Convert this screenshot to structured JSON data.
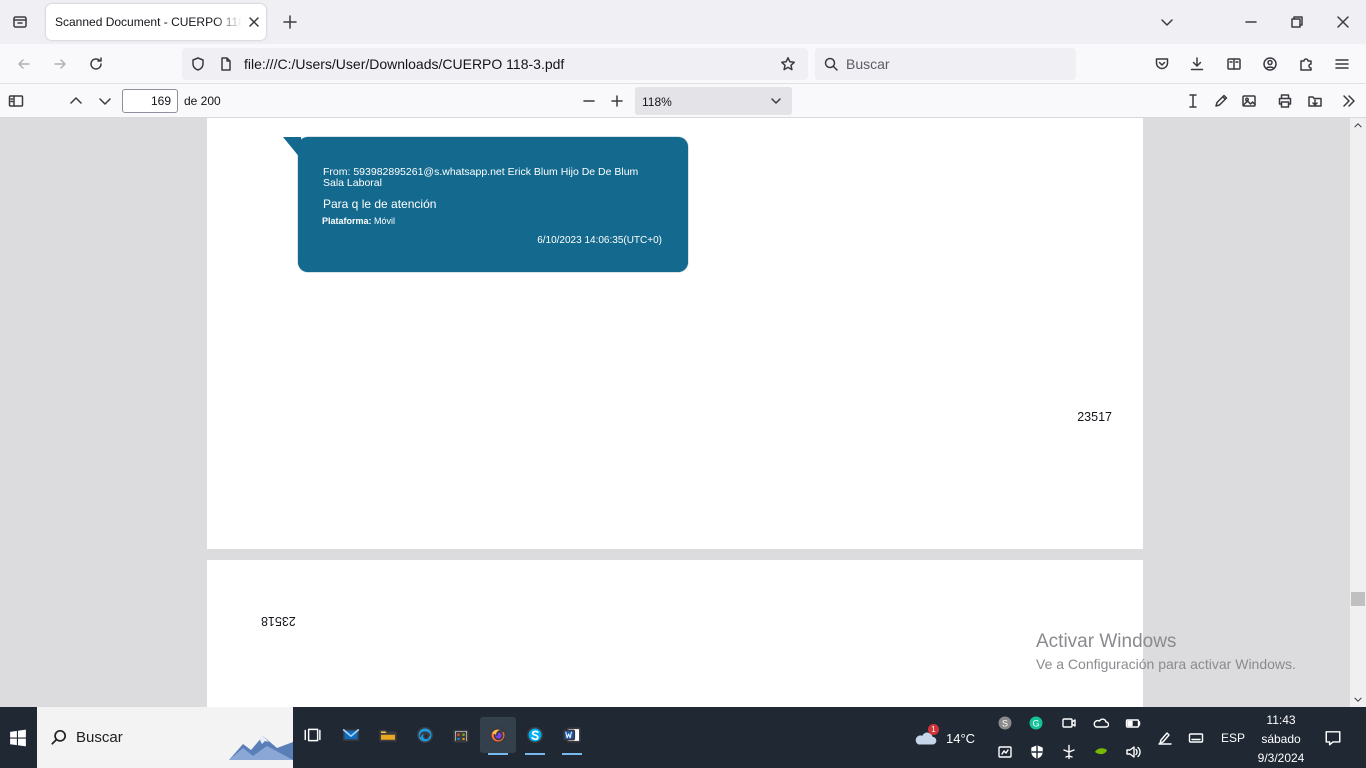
{
  "browser": {
    "tab_title": "Scanned Document - CUERPO 118-3.pdf",
    "url": "file:///C:/Users/User/Downloads/CUERPO 118-3.pdf",
    "search_placeholder": "Buscar"
  },
  "pdf_toolbar": {
    "page_number": "169",
    "page_count": "de 200",
    "zoom": "118%"
  },
  "document": {
    "message": {
      "from_line1": "From: 593982895261@s.whatsapp.net Erick Blum Hijo De De Blum",
      "from_line2": "Sala Laboral",
      "text": "Para q le de atención",
      "platform_label": "Plataforma:",
      "platform_value": "Móvil",
      "timestamp": "6/10/2023 14:06:35(UTC+0)",
      "bubble_color": "#146a8e"
    },
    "page_number_1": "23517",
    "page_number_2": "23518"
  },
  "watermark": {
    "line1": "Activar Windows",
    "line2": "Ve a Configuración para activar Windows."
  },
  "taskbar": {
    "search_placeholder": "Buscar",
    "weather_temp": "14°C",
    "weather_badge": "1",
    "language": "ESP",
    "time": "11:43",
    "day": "sábado",
    "date": "9/3/2024"
  }
}
